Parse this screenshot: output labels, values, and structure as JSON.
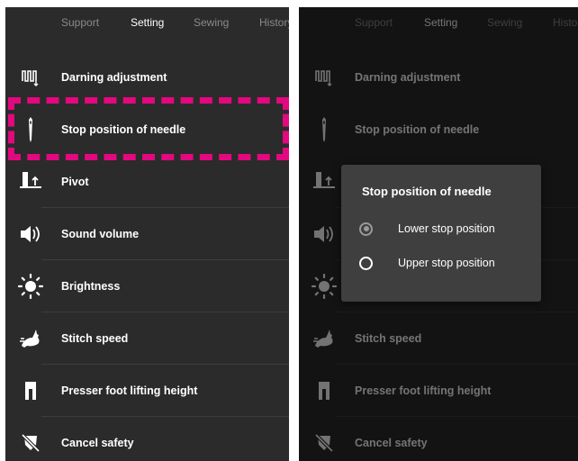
{
  "tabs": [
    {
      "label": "Support",
      "active": false
    },
    {
      "label": "Setting",
      "active": true
    },
    {
      "label": "Sewing",
      "active": false
    },
    {
      "label": "History",
      "active": false
    }
  ],
  "settings": [
    {
      "label": "Darning adjustment",
      "icon": "darning-icon"
    },
    {
      "label": "Stop position of needle",
      "icon": "needle-icon"
    },
    {
      "label": "Pivot",
      "icon": "pivot-icon"
    },
    {
      "label": "Sound volume",
      "icon": "speaker-icon"
    },
    {
      "label": "Brightness",
      "icon": "sun-icon"
    },
    {
      "label": "Stitch speed",
      "icon": "rabbit-icon"
    },
    {
      "label": "Presser foot lifting height",
      "icon": "presser-foot-icon"
    },
    {
      "label": "Cancel safety",
      "icon": "cancel-safety-icon"
    }
  ],
  "dialog": {
    "title": "Stop position of needle",
    "options": [
      {
        "label": "Lower stop position",
        "selected": true
      },
      {
        "label": "Upper stop position",
        "selected": false
      }
    ]
  },
  "colors": {
    "background": "#2b2b2b",
    "highlight": "#e3087f",
    "dialog": "#3f3f3f"
  }
}
